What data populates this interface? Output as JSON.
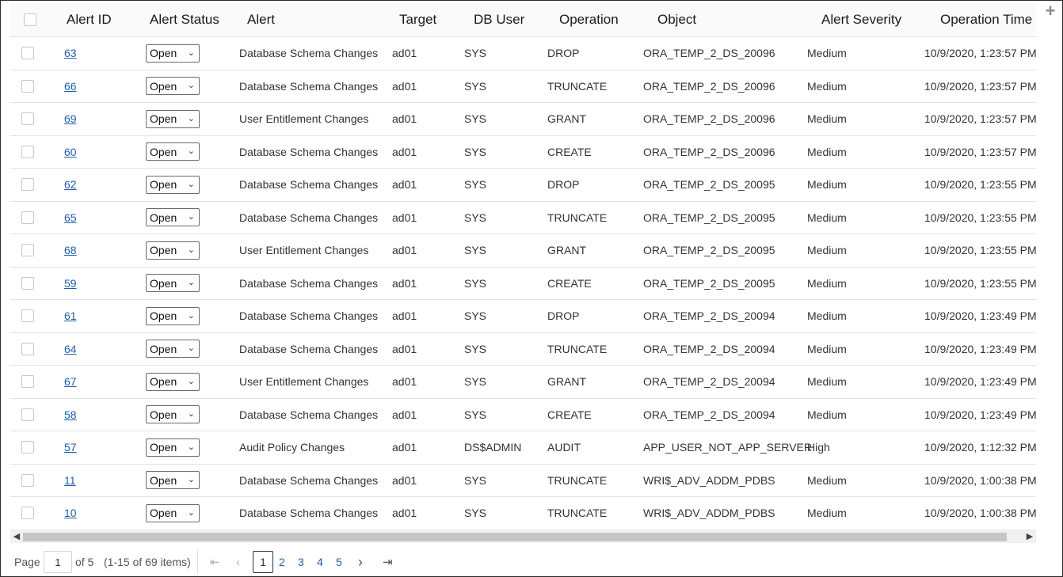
{
  "toolbar": {
    "add_icon": "plus-icon"
  },
  "columns": {
    "alert_id": "Alert ID",
    "alert_status": "Alert Status",
    "alert": "Alert",
    "target": "Target",
    "db_user": "DB User",
    "operation": "Operation",
    "object": "Object",
    "alert_severity": "Alert Severity",
    "operation_time": "Operation Time"
  },
  "rows": [
    {
      "id": "63",
      "status": "Open",
      "alert": "Database Schema Changes",
      "target": "ad01",
      "db_user": "SYS",
      "operation": "DROP",
      "object": "ORA_TEMP_2_DS_20096",
      "severity": "Medium",
      "time": "10/9/2020, 1:23:57 PM"
    },
    {
      "id": "66",
      "status": "Open",
      "alert": "Database Schema Changes",
      "target": "ad01",
      "db_user": "SYS",
      "operation": "TRUNCATE",
      "object": "ORA_TEMP_2_DS_20096",
      "severity": "Medium",
      "time": "10/9/2020, 1:23:57 PM"
    },
    {
      "id": "69",
      "status": "Open",
      "alert": "User Entitlement Changes",
      "target": "ad01",
      "db_user": "SYS",
      "operation": "GRANT",
      "object": "ORA_TEMP_2_DS_20096",
      "severity": "Medium",
      "time": "10/9/2020, 1:23:57 PM"
    },
    {
      "id": "60",
      "status": "Open",
      "alert": "Database Schema Changes",
      "target": "ad01",
      "db_user": "SYS",
      "operation": "CREATE",
      "object": "ORA_TEMP_2_DS_20096",
      "severity": "Medium",
      "time": "10/9/2020, 1:23:57 PM"
    },
    {
      "id": "62",
      "status": "Open",
      "alert": "Database Schema Changes",
      "target": "ad01",
      "db_user": "SYS",
      "operation": "DROP",
      "object": "ORA_TEMP_2_DS_20095",
      "severity": "Medium",
      "time": "10/9/2020, 1:23:55 PM"
    },
    {
      "id": "65",
      "status": "Open",
      "alert": "Database Schema Changes",
      "target": "ad01",
      "db_user": "SYS",
      "operation": "TRUNCATE",
      "object": "ORA_TEMP_2_DS_20095",
      "severity": "Medium",
      "time": "10/9/2020, 1:23:55 PM"
    },
    {
      "id": "68",
      "status": "Open",
      "alert": "User Entitlement Changes",
      "target": "ad01",
      "db_user": "SYS",
      "operation": "GRANT",
      "object": "ORA_TEMP_2_DS_20095",
      "severity": "Medium",
      "time": "10/9/2020, 1:23:55 PM"
    },
    {
      "id": "59",
      "status": "Open",
      "alert": "Database Schema Changes",
      "target": "ad01",
      "db_user": "SYS",
      "operation": "CREATE",
      "object": "ORA_TEMP_2_DS_20095",
      "severity": "Medium",
      "time": "10/9/2020, 1:23:55 PM"
    },
    {
      "id": "61",
      "status": "Open",
      "alert": "Database Schema Changes",
      "target": "ad01",
      "db_user": "SYS",
      "operation": "DROP",
      "object": "ORA_TEMP_2_DS_20094",
      "severity": "Medium",
      "time": "10/9/2020, 1:23:49 PM"
    },
    {
      "id": "64",
      "status": "Open",
      "alert": "Database Schema Changes",
      "target": "ad01",
      "db_user": "SYS",
      "operation": "TRUNCATE",
      "object": "ORA_TEMP_2_DS_20094",
      "severity": "Medium",
      "time": "10/9/2020, 1:23:49 PM"
    },
    {
      "id": "67",
      "status": "Open",
      "alert": "User Entitlement Changes",
      "target": "ad01",
      "db_user": "SYS",
      "operation": "GRANT",
      "object": "ORA_TEMP_2_DS_20094",
      "severity": "Medium",
      "time": "10/9/2020, 1:23:49 PM"
    },
    {
      "id": "58",
      "status": "Open",
      "alert": "Database Schema Changes",
      "target": "ad01",
      "db_user": "SYS",
      "operation": "CREATE",
      "object": "ORA_TEMP_2_DS_20094",
      "severity": "Medium",
      "time": "10/9/2020, 1:23:49 PM"
    },
    {
      "id": "57",
      "status": "Open",
      "alert": "Audit Policy Changes",
      "target": "ad01",
      "db_user": "DS$ADMIN",
      "operation": "AUDIT",
      "object": "APP_USER_NOT_APP_SERVER",
      "severity": "High",
      "time": "10/9/2020, 1:12:32 PM"
    },
    {
      "id": "11",
      "status": "Open",
      "alert": "Database Schema Changes",
      "target": "ad01",
      "db_user": "SYS",
      "operation": "TRUNCATE",
      "object": "WRI$_ADV_ADDM_PDBS",
      "severity": "Medium",
      "time": "10/9/2020, 1:00:38 PM"
    },
    {
      "id": "10",
      "status": "Open",
      "alert": "Database Schema Changes",
      "target": "ad01",
      "db_user": "SYS",
      "operation": "TRUNCATE",
      "object": "WRI$_ADV_ADDM_PDBS",
      "severity": "Medium",
      "time": "10/9/2020, 1:00:38 PM"
    }
  ],
  "pagination": {
    "page_label": "Page",
    "current_page": "1",
    "of_label": "of 5",
    "range_label": "(1-15 of 69 items)",
    "pages": [
      "1",
      "2",
      "3",
      "4",
      "5"
    ]
  }
}
